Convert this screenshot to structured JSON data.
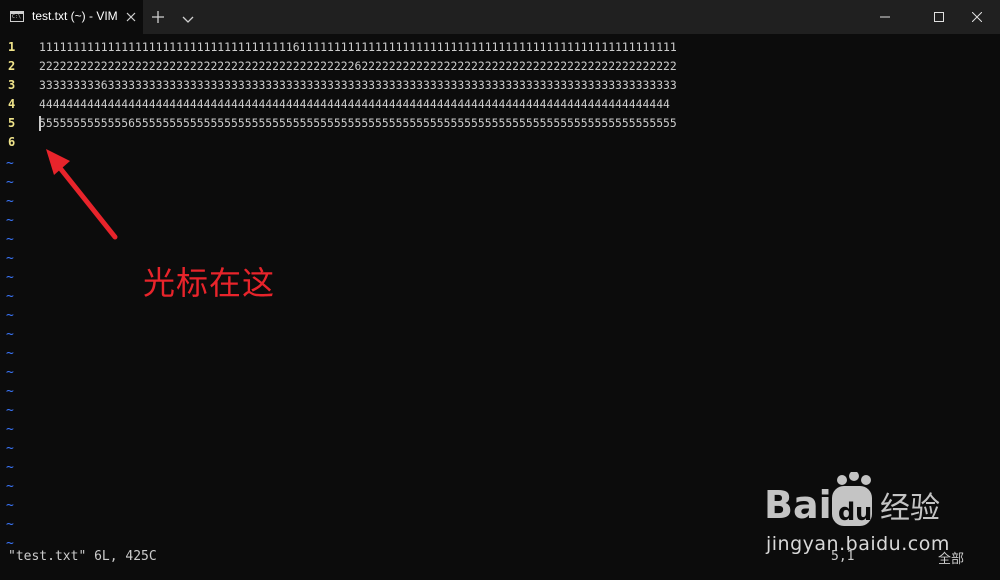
{
  "window": {
    "tab_title": "test.txt (~) - VIM"
  },
  "editor": {
    "lines": [
      {
        "num": "1",
        "text": "111111111111111111111111111111111111161111111111111111111111111111111111111111111111111111111"
      },
      {
        "num": "2",
        "text": "222222222222222222222222222222222222222222222262222222222222222222222222222222222222222222222"
      },
      {
        "num": "3",
        "text": "333333333633333333333333333333333333333333333333333333333333333333333333333333333333333333333"
      },
      {
        "num": "4",
        "text": "44444444444444444444444444444444444444444444444444444444444444444444444444444444444444444444"
      },
      {
        "num": "5",
        "text": "555555555555565555555555555555555555555555555555555555555555555555555555555555555555555555555"
      },
      {
        "num": "6",
        "text": ""
      }
    ],
    "tilde": "~"
  },
  "annotation": {
    "label": "光标在这",
    "color": "#e8242b"
  },
  "statusline": {
    "file_info": "\"test.txt\" 6L, 425C",
    "position": "5,1",
    "scroll": "全部"
  },
  "watermark": {
    "url": "jingyan.baidu.com"
  }
}
